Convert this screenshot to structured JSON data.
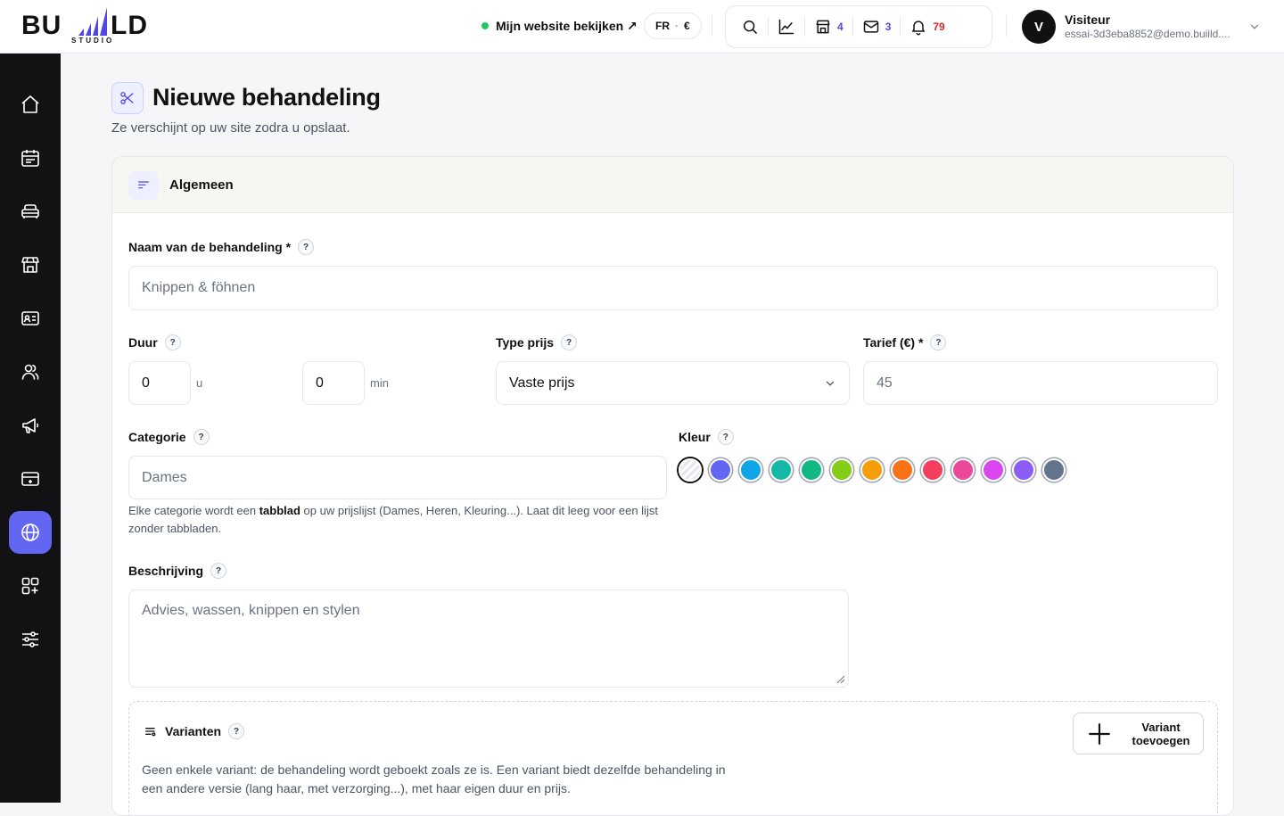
{
  "brand": {
    "left": "BU",
    "right": "LD",
    "sub": "STUDIO"
  },
  "topbar": {
    "site_link": "Mijn website bekijken ↗",
    "lang": "FR",
    "currency": "€",
    "counts": {
      "shop": "4",
      "mail": "3",
      "notifications": "79"
    }
  },
  "user": {
    "initial": "V",
    "name": "Visiteur",
    "email": "essai-3d3eba8852@demo.buiild...."
  },
  "sidebar": {
    "items": [
      "home-icon",
      "calendar-icon",
      "services-icon",
      "store-icon",
      "contact-card-icon",
      "users-icon",
      "megaphone-icon",
      "payment-icon",
      "globe-icon",
      "apps-icon",
      "settings-icon"
    ],
    "active": "globe-icon"
  },
  "page": {
    "title": "Nieuwe behandeling",
    "subtitle": "Ze verschijnt op uw site zodra u opslaat."
  },
  "section": {
    "title": "Algemeen"
  },
  "form": {
    "name_label": "Naam van de behandeling *",
    "name_placeholder": "Knippen & föhnen",
    "duration_label": "Duur",
    "hours_value": "0",
    "hours_unit": "u",
    "minutes_value": "0",
    "minutes_unit": "min",
    "price_type_label": "Type prijs",
    "price_type_value": "Vaste prijs",
    "rate_label": "Tarief (€) *",
    "rate_placeholder": "45",
    "category_label": "Categorie",
    "category_placeholder": "Dames",
    "category_hint_1": "Elke categorie wordt een ",
    "category_hint_bold": "tabblad",
    "category_hint_2": " op uw prijslijst (Dames, Heren, Kleuring...). Laat dit leeg voor een lijst zonder tabbladen.",
    "color_label": "Kleur",
    "colors": [
      "none",
      "#6366f1",
      "#0ea5e9",
      "#14b8a6",
      "#10b981",
      "#84cc16",
      "#f59e0b",
      "#f97316",
      "#f43f5e",
      "#ec4899",
      "#d946ef",
      "#8b5cf6",
      "#64748b"
    ],
    "description_label": "Beschrijving",
    "description_placeholder": "Advies, wassen, knippen en stylen",
    "help": "?"
  },
  "variants": {
    "title": "Varianten",
    "text": "Geen enkele variant: de behandeling wordt geboekt zoals ze is. Een variant biedt dezelfde behandeling in een andere versie (lang haar, met verzorging...), met haar eigen duur en prijs.",
    "add_label": "Variant toevoegen"
  }
}
